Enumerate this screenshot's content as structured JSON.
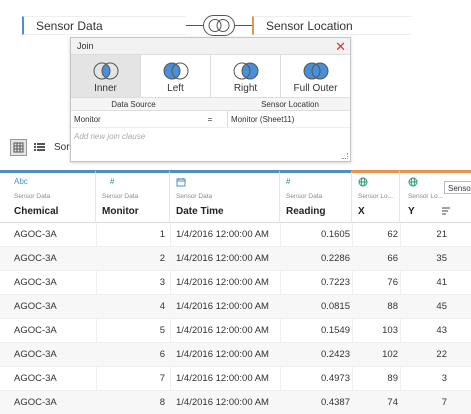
{
  "canvas": {
    "left_table": "Sensor Data",
    "right_table": "Sensor Location"
  },
  "join_dialog": {
    "title": "Join",
    "close_glyph": "✕",
    "join_types": [
      {
        "label": "Inner",
        "active": true
      },
      {
        "label": "Left",
        "active": false
      },
      {
        "label": "Right",
        "active": false
      },
      {
        "label": "Full Outer",
        "active": false
      }
    ],
    "clause_header": {
      "data_source": "Data Source",
      "right": "Sensor Location"
    },
    "clause": {
      "left": "Monitor",
      "operator": "=",
      "right": "Monitor (Sheet11)"
    },
    "add_clause_placeholder": "Add new join clause"
  },
  "toolbar": {
    "sort_label": "Sor"
  },
  "columns": [
    {
      "type_icon": "Abc",
      "source": "Sensor Data",
      "field": "Chemical"
    },
    {
      "type_icon": "#",
      "source": "Sensor Data",
      "field": "Monitor"
    },
    {
      "type_icon": "calendar-icon",
      "source": "Sensor Data",
      "field": "Date Time"
    },
    {
      "type_icon": "#",
      "source": "Sensor Data",
      "field": "Reading"
    },
    {
      "type_icon": "globe-icon",
      "source": "Sensor Lo...",
      "field": "X"
    },
    {
      "type_icon": "globe-icon",
      "source": "Sensor Lo...",
      "field": "Y"
    }
  ],
  "tooltip": "Senso",
  "rows": [
    {
      "chemical": "AGOC-3A",
      "monitor": "1",
      "datetime": "1/4/2016 12:00:00 AM",
      "reading": "0.1605",
      "x": "62",
      "y": "21"
    },
    {
      "chemical": "AGOC-3A",
      "monitor": "2",
      "datetime": "1/4/2016 12:00:00 AM",
      "reading": "0.2286",
      "x": "66",
      "y": "35"
    },
    {
      "chemical": "AGOC-3A",
      "monitor": "3",
      "datetime": "1/4/2016 12:00:00 AM",
      "reading": "0.7223",
      "x": "76",
      "y": "41"
    },
    {
      "chemical": "AGOC-3A",
      "monitor": "4",
      "datetime": "1/4/2016 12:00:00 AM",
      "reading": "0.0815",
      "x": "88",
      "y": "45"
    },
    {
      "chemical": "AGOC-3A",
      "monitor": "5",
      "datetime": "1/4/2016 12:00:00 AM",
      "reading": "0.1549",
      "x": "103",
      "y": "43"
    },
    {
      "chemical": "AGOC-3A",
      "monitor": "6",
      "datetime": "1/4/2016 12:00:00 AM",
      "reading": "0.2423",
      "x": "102",
      "y": "22"
    },
    {
      "chemical": "AGOC-3A",
      "monitor": "7",
      "datetime": "1/4/2016 12:00:00 AM",
      "reading": "0.4973",
      "x": "89",
      "y": "3"
    },
    {
      "chemical": "AGOC-3A",
      "monitor": "8",
      "datetime": "1/4/2016 12:00:00 AM",
      "reading": "0.4387",
      "x": "74",
      "y": "7"
    }
  ],
  "colors": {
    "left_accent": "#4e8fc4",
    "right_accent": "#e8944a",
    "close": "#d9342b",
    "venn_fill": "#4a90d9"
  }
}
